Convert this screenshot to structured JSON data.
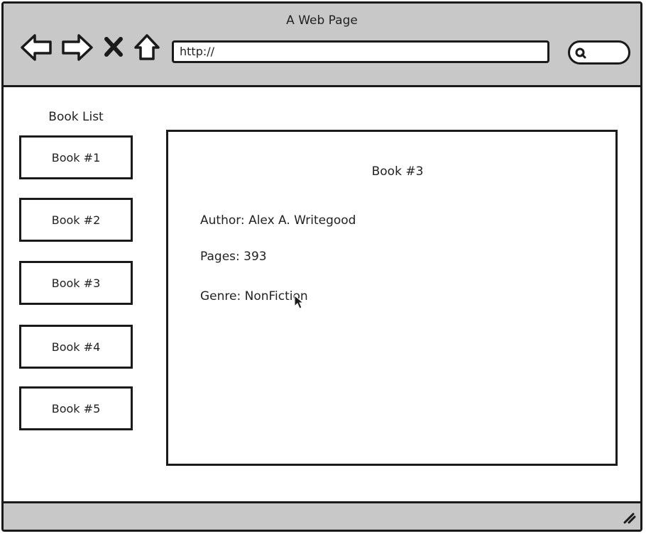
{
  "window": {
    "title": "A Web Page"
  },
  "toolbar": {
    "back_icon": "back-arrow-icon",
    "forward_icon": "forward-arrow-icon",
    "stop_icon": "close-icon",
    "home_icon": "home-icon",
    "url_value": "http://",
    "search_icon": "search-icon",
    "search_value": ""
  },
  "sidebar": {
    "heading": "Book List",
    "items": [
      {
        "label": "Book #1"
      },
      {
        "label": "Book #2"
      },
      {
        "label": "Book #3"
      },
      {
        "label": "Book #4"
      },
      {
        "label": "Book #5"
      }
    ]
  },
  "detail": {
    "title": "Book #3",
    "author": "Author: Alex A. Writegood",
    "pages": "Pages: 393",
    "genre": "Genre: NonFiction"
  },
  "colors": {
    "chrome": "#c8c8c8",
    "border": "#1a1a1a",
    "background": "#ffffff"
  }
}
